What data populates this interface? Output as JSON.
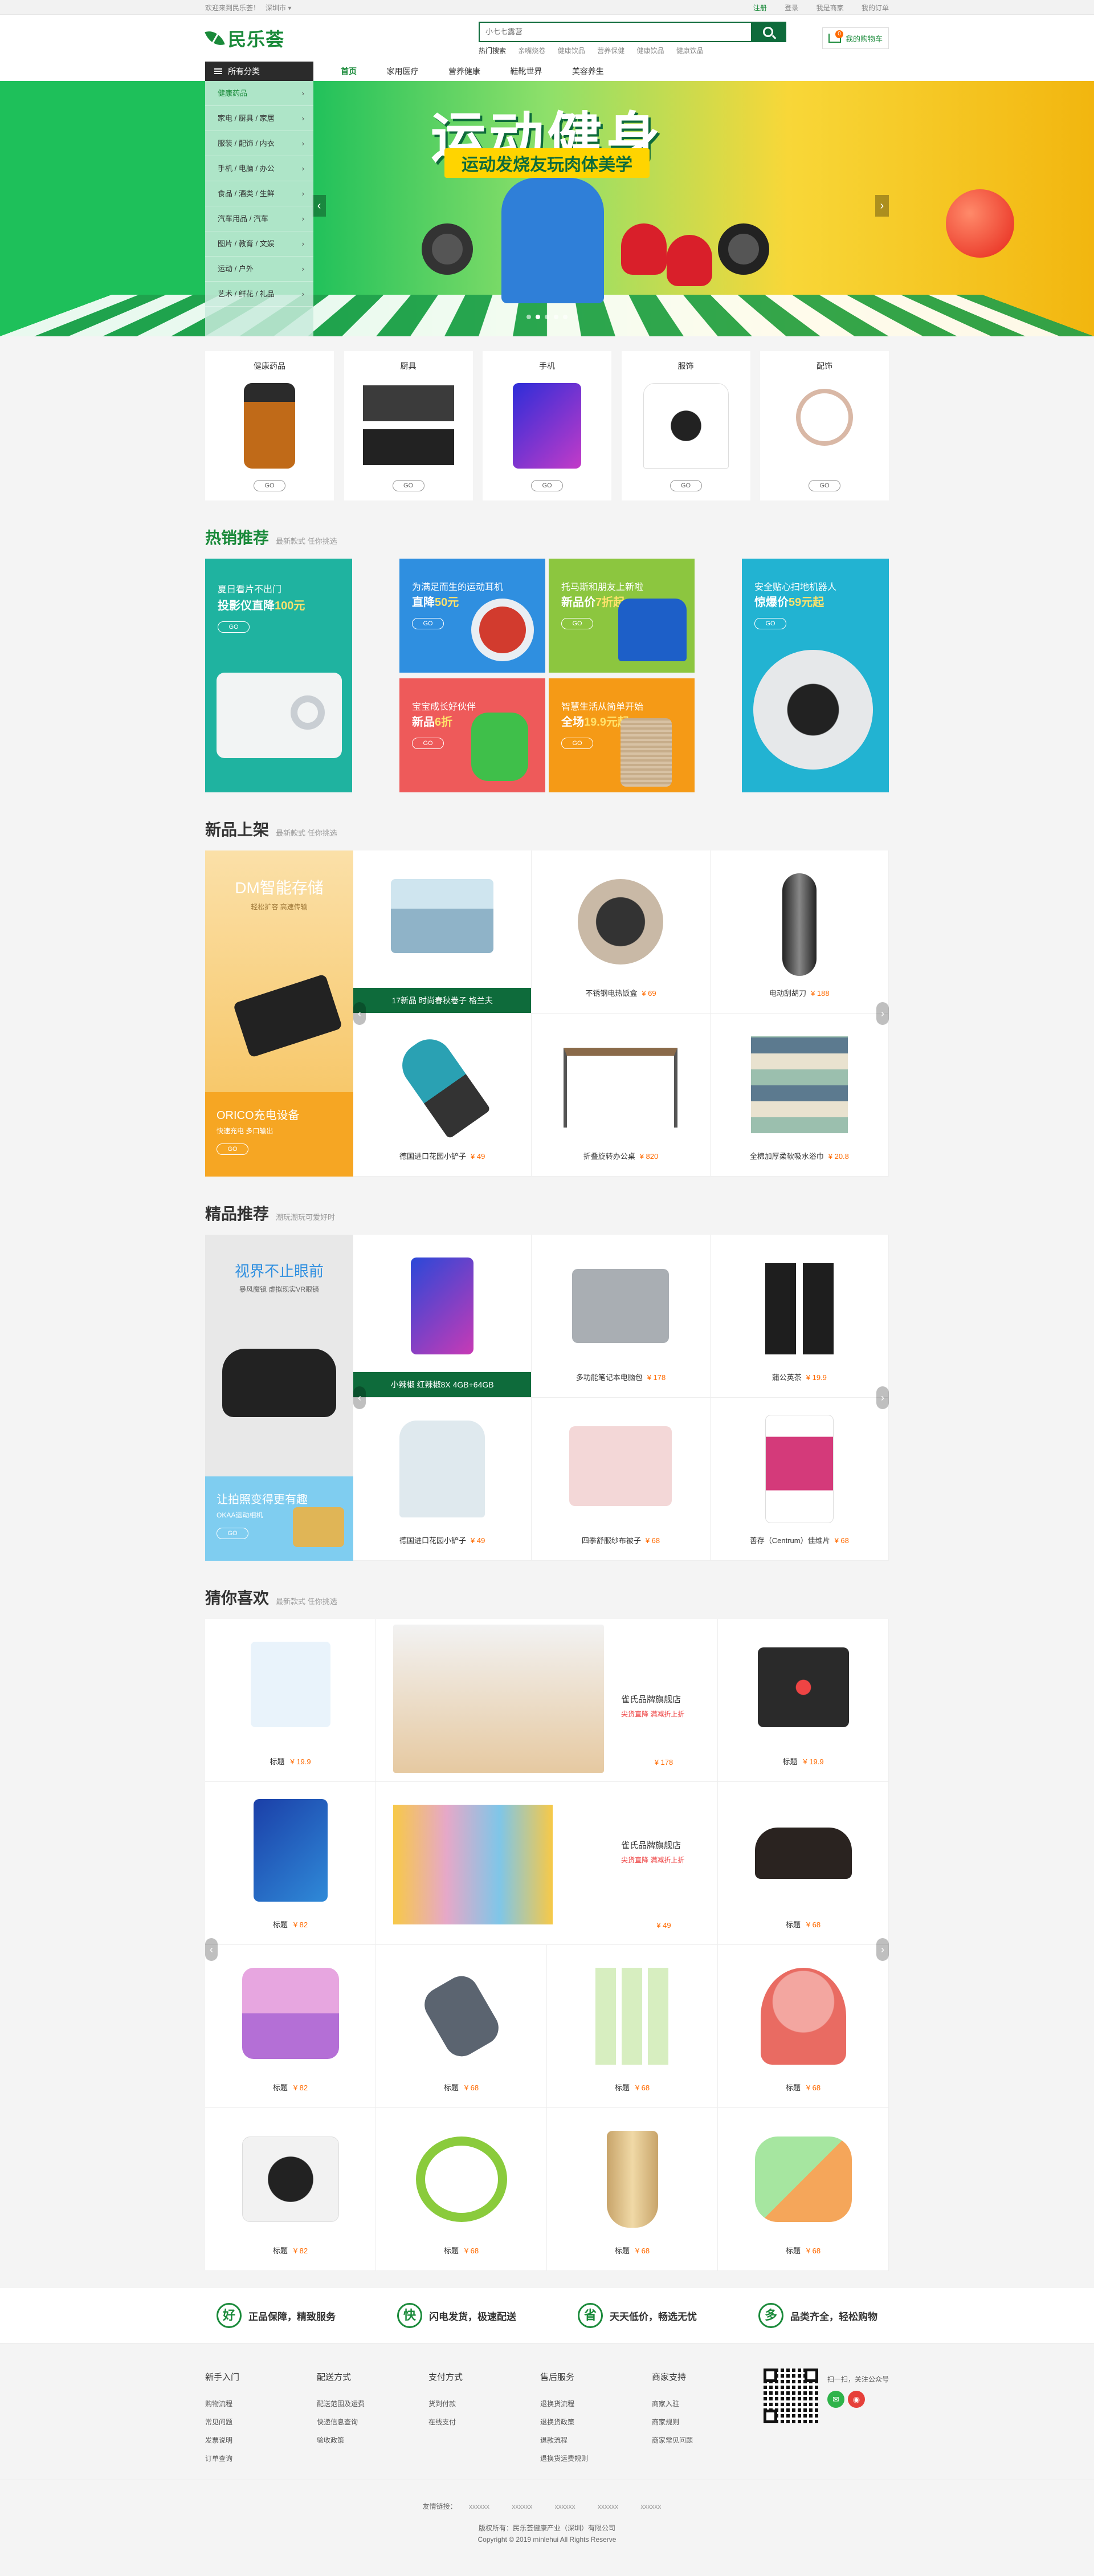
{
  "topbar": {
    "welcome": "欢迎来到民乐荟！",
    "city": "深圳市",
    "login": "注册",
    "register": "登录",
    "vip": "我是商家",
    "orders": "我的订单"
  },
  "brand": {
    "name": "民乐荟",
    "accent": "#1a8a3a",
    "dark_green": "#0e6b3b",
    "price_orange": "#ff6a00"
  },
  "search": {
    "placeholder": "小七七露营",
    "hot_label": "热门搜索",
    "hot": [
      "亲嘴烧卷",
      "健康饮品",
      "营养保健",
      "健康饮品",
      "健康饮品"
    ]
  },
  "cart": {
    "label": "我的购物车",
    "count": "0"
  },
  "nav": {
    "all_categories": "所有分类",
    "items": [
      "首页",
      "家用医疗",
      "营养健康",
      "鞋靴世界",
      "美容养生"
    ]
  },
  "categories": [
    "健康药品",
    "家电 / 厨具 / 家居",
    "服装 / 配饰 / 内衣",
    "手机 / 电脑 / 办公",
    "食品 / 酒类 / 生鲜",
    "汽车用品 / 汽车",
    "图片 / 教育 / 文娱",
    "运动 / 户外",
    "艺术 / 鲜花 / 礼品"
  ],
  "banner": {
    "title": "运动健身",
    "subtitle": "运动发烧友玩肉体美学"
  },
  "quick": [
    {
      "label": "健康药品",
      "go": "GO"
    },
    {
      "label": "厨具",
      "go": "GO"
    },
    {
      "label": "手机",
      "go": "GO"
    },
    {
      "label": "服饰",
      "go": "GO"
    },
    {
      "label": "配饰",
      "go": "GO"
    }
  ],
  "hot": {
    "title": "热销推荐",
    "subtitle": "最新款式  任你挑选",
    "cards": [
      {
        "l1": "夏日看片不出门",
        "l2a": "投影仪直降",
        "l2b": "100元",
        "go": "GO",
        "color": "#1fb3a0"
      },
      {
        "l1": "为满足而生的运动耳机",
        "l2a": "直降",
        "l2b": "50元",
        "go": "GO",
        "color": "#2f8fe0"
      },
      {
        "l1": "托马斯和朋友上新啦",
        "l2a": "新品价",
        "l2b": "7折起",
        "go": "GO",
        "color": "#8cc63f"
      },
      {
        "l1": "安全贴心扫地机器人",
        "l2a": "惊爆价",
        "l2b": "59元起",
        "go": "GO",
        "color": "#22b3d2"
      },
      {
        "l1": "宝宝成长好伙伴",
        "l2a": "新品",
        "l2b": "6折",
        "go": "GO",
        "color": "#ee5a5a"
      },
      {
        "l1": "智慧生活从简单开始",
        "l2a": "全场",
        "l2b": "19.9元起",
        "go": "GO",
        "color": "#f59a16"
      }
    ]
  },
  "newarr": {
    "title": "新品上架",
    "subtitle": "最新款式  任你挑选",
    "ad_top": {
      "title": "DM智能存储",
      "sub": "轻松扩容 高速传输"
    },
    "ad_bottom": {
      "title": "ORICO充电设备",
      "sub": "快速充电 多口输出",
      "go": "GO"
    },
    "items": [
      {
        "name": "17新品 时尚春秋卷子 格兰夫",
        "price": "",
        "band": true
      },
      {
        "name": "不锈钢电热饭盒",
        "price": "¥ 69"
      },
      {
        "name": "电动刮胡刀",
        "price": "¥ 188"
      },
      {
        "name": "德国进口花园小铲子",
        "price": "¥ 49"
      },
      {
        "name": "折叠旋转办公桌",
        "price": "¥ 820"
      },
      {
        "name": "全棉加厚柔软吸水浴巾",
        "price": "¥ 20.8"
      }
    ]
  },
  "premium": {
    "title": "精品推荐",
    "subtitle": "潮玩潮玩可爱好时",
    "ad_top": {
      "title": "视界不止眼前",
      "sub": "暴风魔镜 虚拟现实VR眼镜"
    },
    "ad_bottom": {
      "title": "让拍照变得更有趣",
      "sub": "OKAA运动相机",
      "go": "GO"
    },
    "items": [
      {
        "name": "小辣椒 红辣椒8X 4GB+64GB",
        "price": "",
        "band": true
      },
      {
        "name": "多功能笔记本电脑包",
        "price": "¥ 178"
      },
      {
        "name": "蒲公英茶",
        "price": "¥ 19.9"
      },
      {
        "name": "德国进口花园小铲子",
        "price": "¥ 49"
      },
      {
        "name": "四季舒服纱布被子",
        "price": "¥ 68"
      },
      {
        "name": "善存（Centrum）佳维片",
        "price": "¥ 68"
      }
    ]
  },
  "guess": {
    "title": "猜你喜欢",
    "subtitle": "最新款式  任你挑选",
    "shop_name": "雀氏品牌旗舰店",
    "shop_tag": "尖货直降 满减折上折",
    "items": [
      {
        "name": "标题",
        "price": "¥ 19.9"
      },
      {
        "name": "",
        "price": "¥ 178",
        "wide": true
      },
      {
        "name": "标题",
        "price": "¥ 19.9"
      },
      {
        "name": "标题",
        "price": "¥ 82"
      },
      {
        "name": "",
        "price": "¥ 49",
        "wide": true
      },
      {
        "name": "标题",
        "price": "¥ 68"
      },
      {
        "name": "标题",
        "price": "¥ 82"
      },
      {
        "name": "标题",
        "price": "¥ 68"
      },
      {
        "name": "标题",
        "price": "¥ 68"
      },
      {
        "name": "标题",
        "price": "¥ 68"
      },
      {
        "name": "标题",
        "price": "¥ 82"
      },
      {
        "name": "标题",
        "price": "¥ 68"
      },
      {
        "name": "标题",
        "price": "¥ 68"
      },
      {
        "name": "标题",
        "price": "¥ 68"
      }
    ]
  },
  "promise": [
    {
      "icon": "好",
      "text": "正品保障，精致服务"
    },
    {
      "icon": "快",
      "text": "闪电发货，极速配送"
    },
    {
      "icon": "省",
      "text": "天天低价，畅选无忧"
    },
    {
      "icon": "多",
      "text": "品类齐全，轻松购物"
    }
  ],
  "footer": {
    "cols": [
      {
        "h": "新手入门",
        "items": [
          "购物流程",
          "常见问题",
          "发票说明",
          "订单查询"
        ]
      },
      {
        "h": "配送方式",
        "items": [
          "配送范围及运费",
          "快递信息查询",
          "验收政策"
        ]
      },
      {
        "h": "支付方式",
        "items": [
          "货到付款",
          "在线支付"
        ]
      },
      {
        "h": "售后服务",
        "items": [
          "退换货流程",
          "退换货政策",
          "退款流程",
          "退换货运费规则"
        ]
      },
      {
        "h": "商家支持",
        "items": [
          "商家入驻",
          "商家规则",
          "商家常见问题"
        ]
      }
    ],
    "qr_text": "扫一扫，关注公众号"
  },
  "copyright": {
    "links_label": "友情链接：",
    "links": [
      "xxxxxx",
      "xxxxxx",
      "xxxxxx",
      "xxxxxx",
      "xxxxxx"
    ],
    "line1": "版权所有：民乐荟健康产业（深圳）有限公司",
    "line2": "Copyright © 2019 minlehui  All Rights Reserve"
  }
}
